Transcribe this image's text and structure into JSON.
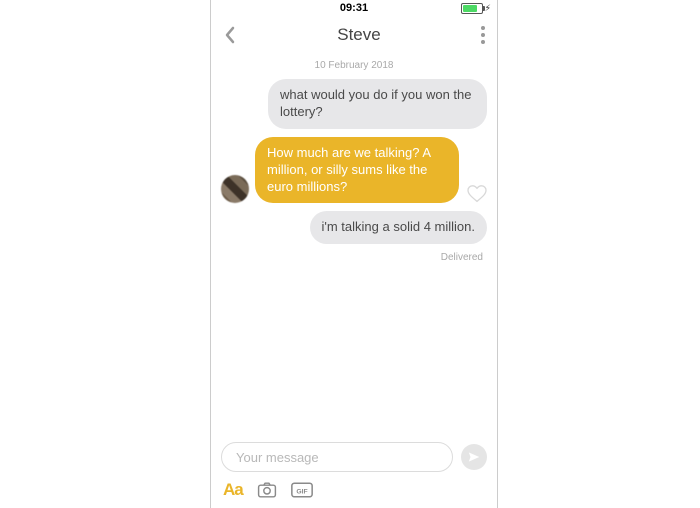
{
  "status": {
    "time": "09:31"
  },
  "header": {
    "title": "Steve"
  },
  "chat": {
    "date_label": "10 February 2018",
    "messages": [
      {
        "text": "what would you do if you won the lottery?"
      },
      {
        "text": "How much are we talking? A million, or silly sums like the euro millions?"
      },
      {
        "text": "i'm talking a solid 4 million."
      }
    ],
    "delivered_label": "Delivered"
  },
  "composer": {
    "placeholder": "Your message",
    "aa_label": "Aa",
    "gif_label": "GIF"
  },
  "colors": {
    "accent": "#eab529",
    "bubble_gray": "#e7e7e9"
  }
}
